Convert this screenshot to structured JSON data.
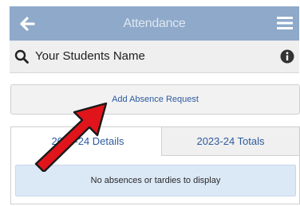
{
  "header": {
    "title": "Attendance",
    "back_icon": "arrow-left-icon",
    "menu_icon": "hamburger-menu-icon",
    "background": "#8ea9c9"
  },
  "search": {
    "text": "Your Students Name",
    "icon": "search-icon",
    "info_icon": "info-icon"
  },
  "actions": {
    "add_absence_label": "Add Absence Request"
  },
  "tabs": [
    {
      "label": "2023-24 Details",
      "active": true
    },
    {
      "label": "2023-24 Totals",
      "active": false
    }
  ],
  "message": "No absences or tardies to display",
  "overlay": {
    "arrow_icon": "red-pointer-arrow",
    "arrow_color": "#e0141b"
  }
}
